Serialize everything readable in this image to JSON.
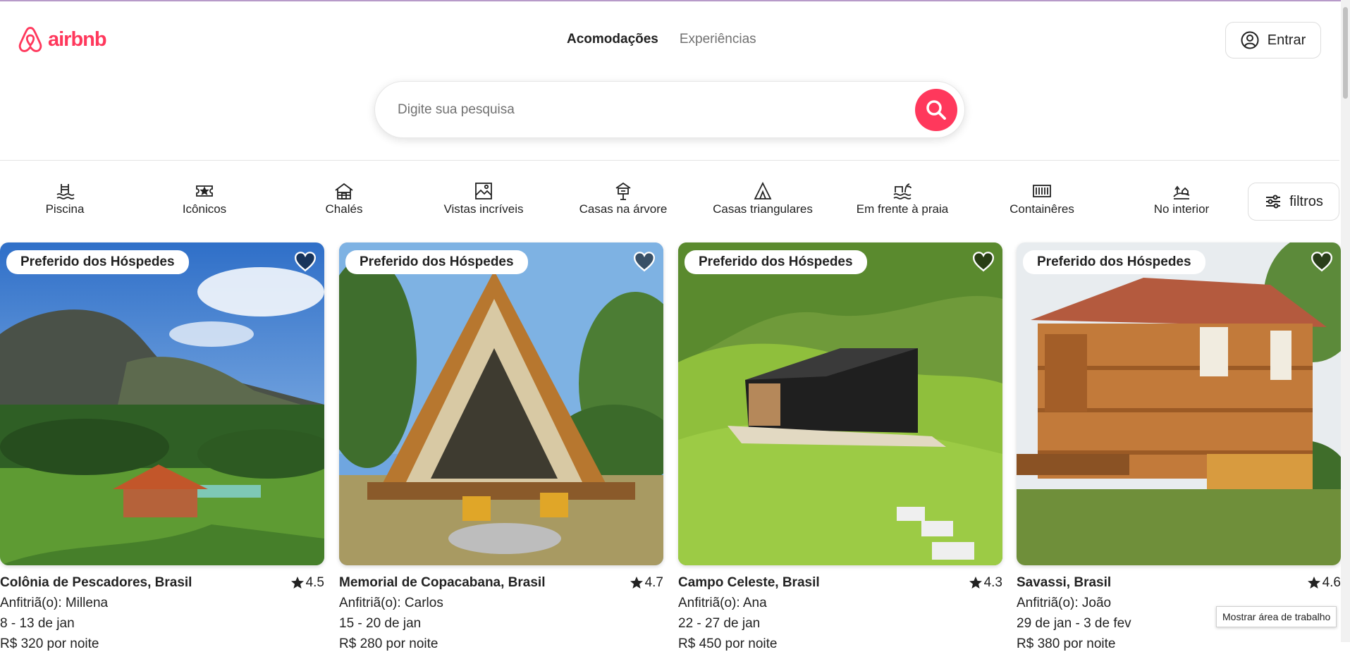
{
  "brand": {
    "name": "airbnb",
    "color": "#ff385c"
  },
  "nav": {
    "stays": "Acomodações",
    "experiences": "Experiências"
  },
  "header": {
    "login_label": "Entrar"
  },
  "search": {
    "placeholder": "Digite sua pesquisa"
  },
  "categories": [
    {
      "label": "Piscina",
      "icon": "pool-icon"
    },
    {
      "label": "Icônicos",
      "icon": "ticket-star-icon"
    },
    {
      "label": "Chalés",
      "icon": "cabin-icon"
    },
    {
      "label": "Vistas incríveis",
      "icon": "landscape-icon"
    },
    {
      "label": "Casas na árvore",
      "icon": "treehouse-icon"
    },
    {
      "label": "Casas triangulares",
      "icon": "a-frame-icon"
    },
    {
      "label": "Em frente à praia",
      "icon": "beach-icon"
    },
    {
      "label": "Containêres",
      "icon": "container-icon"
    },
    {
      "label": "No interior",
      "icon": "countryside-icon"
    }
  ],
  "filters": {
    "label": "filtros"
  },
  "listings": [
    {
      "badge": "Preferido dos Hóspedes",
      "title": "Colônia de Pescadores, Brasil",
      "rating": "4.5",
      "host": "Anfitriã(o): Millena",
      "dates": "8 - 13 de jan",
      "price": "R$ 320 por noite"
    },
    {
      "badge": "Preferido dos Hóspedes",
      "title": "Memorial de Copacabana, Brasil",
      "rating": "4.7",
      "host": "Anfitriã(o): Carlos",
      "dates": "15 - 20 de jan",
      "price": "R$ 280 por noite"
    },
    {
      "badge": "Preferido dos Hóspedes",
      "title": "Campo Celeste, Brasil",
      "rating": "4.3",
      "host": "Anfitriã(o): Ana",
      "dates": "22 - 27 de jan",
      "price": "R$ 450 por noite"
    },
    {
      "badge": "Preferido dos Hóspedes",
      "title": "Savassi, Brasil",
      "rating": "4.6",
      "host": "Anfitriã(o): João",
      "dates": "29 de jan - 3 de fev",
      "price": "R$ 380 por noite"
    }
  ],
  "tooltip": {
    "text": "Mostrar área de trabalho"
  }
}
